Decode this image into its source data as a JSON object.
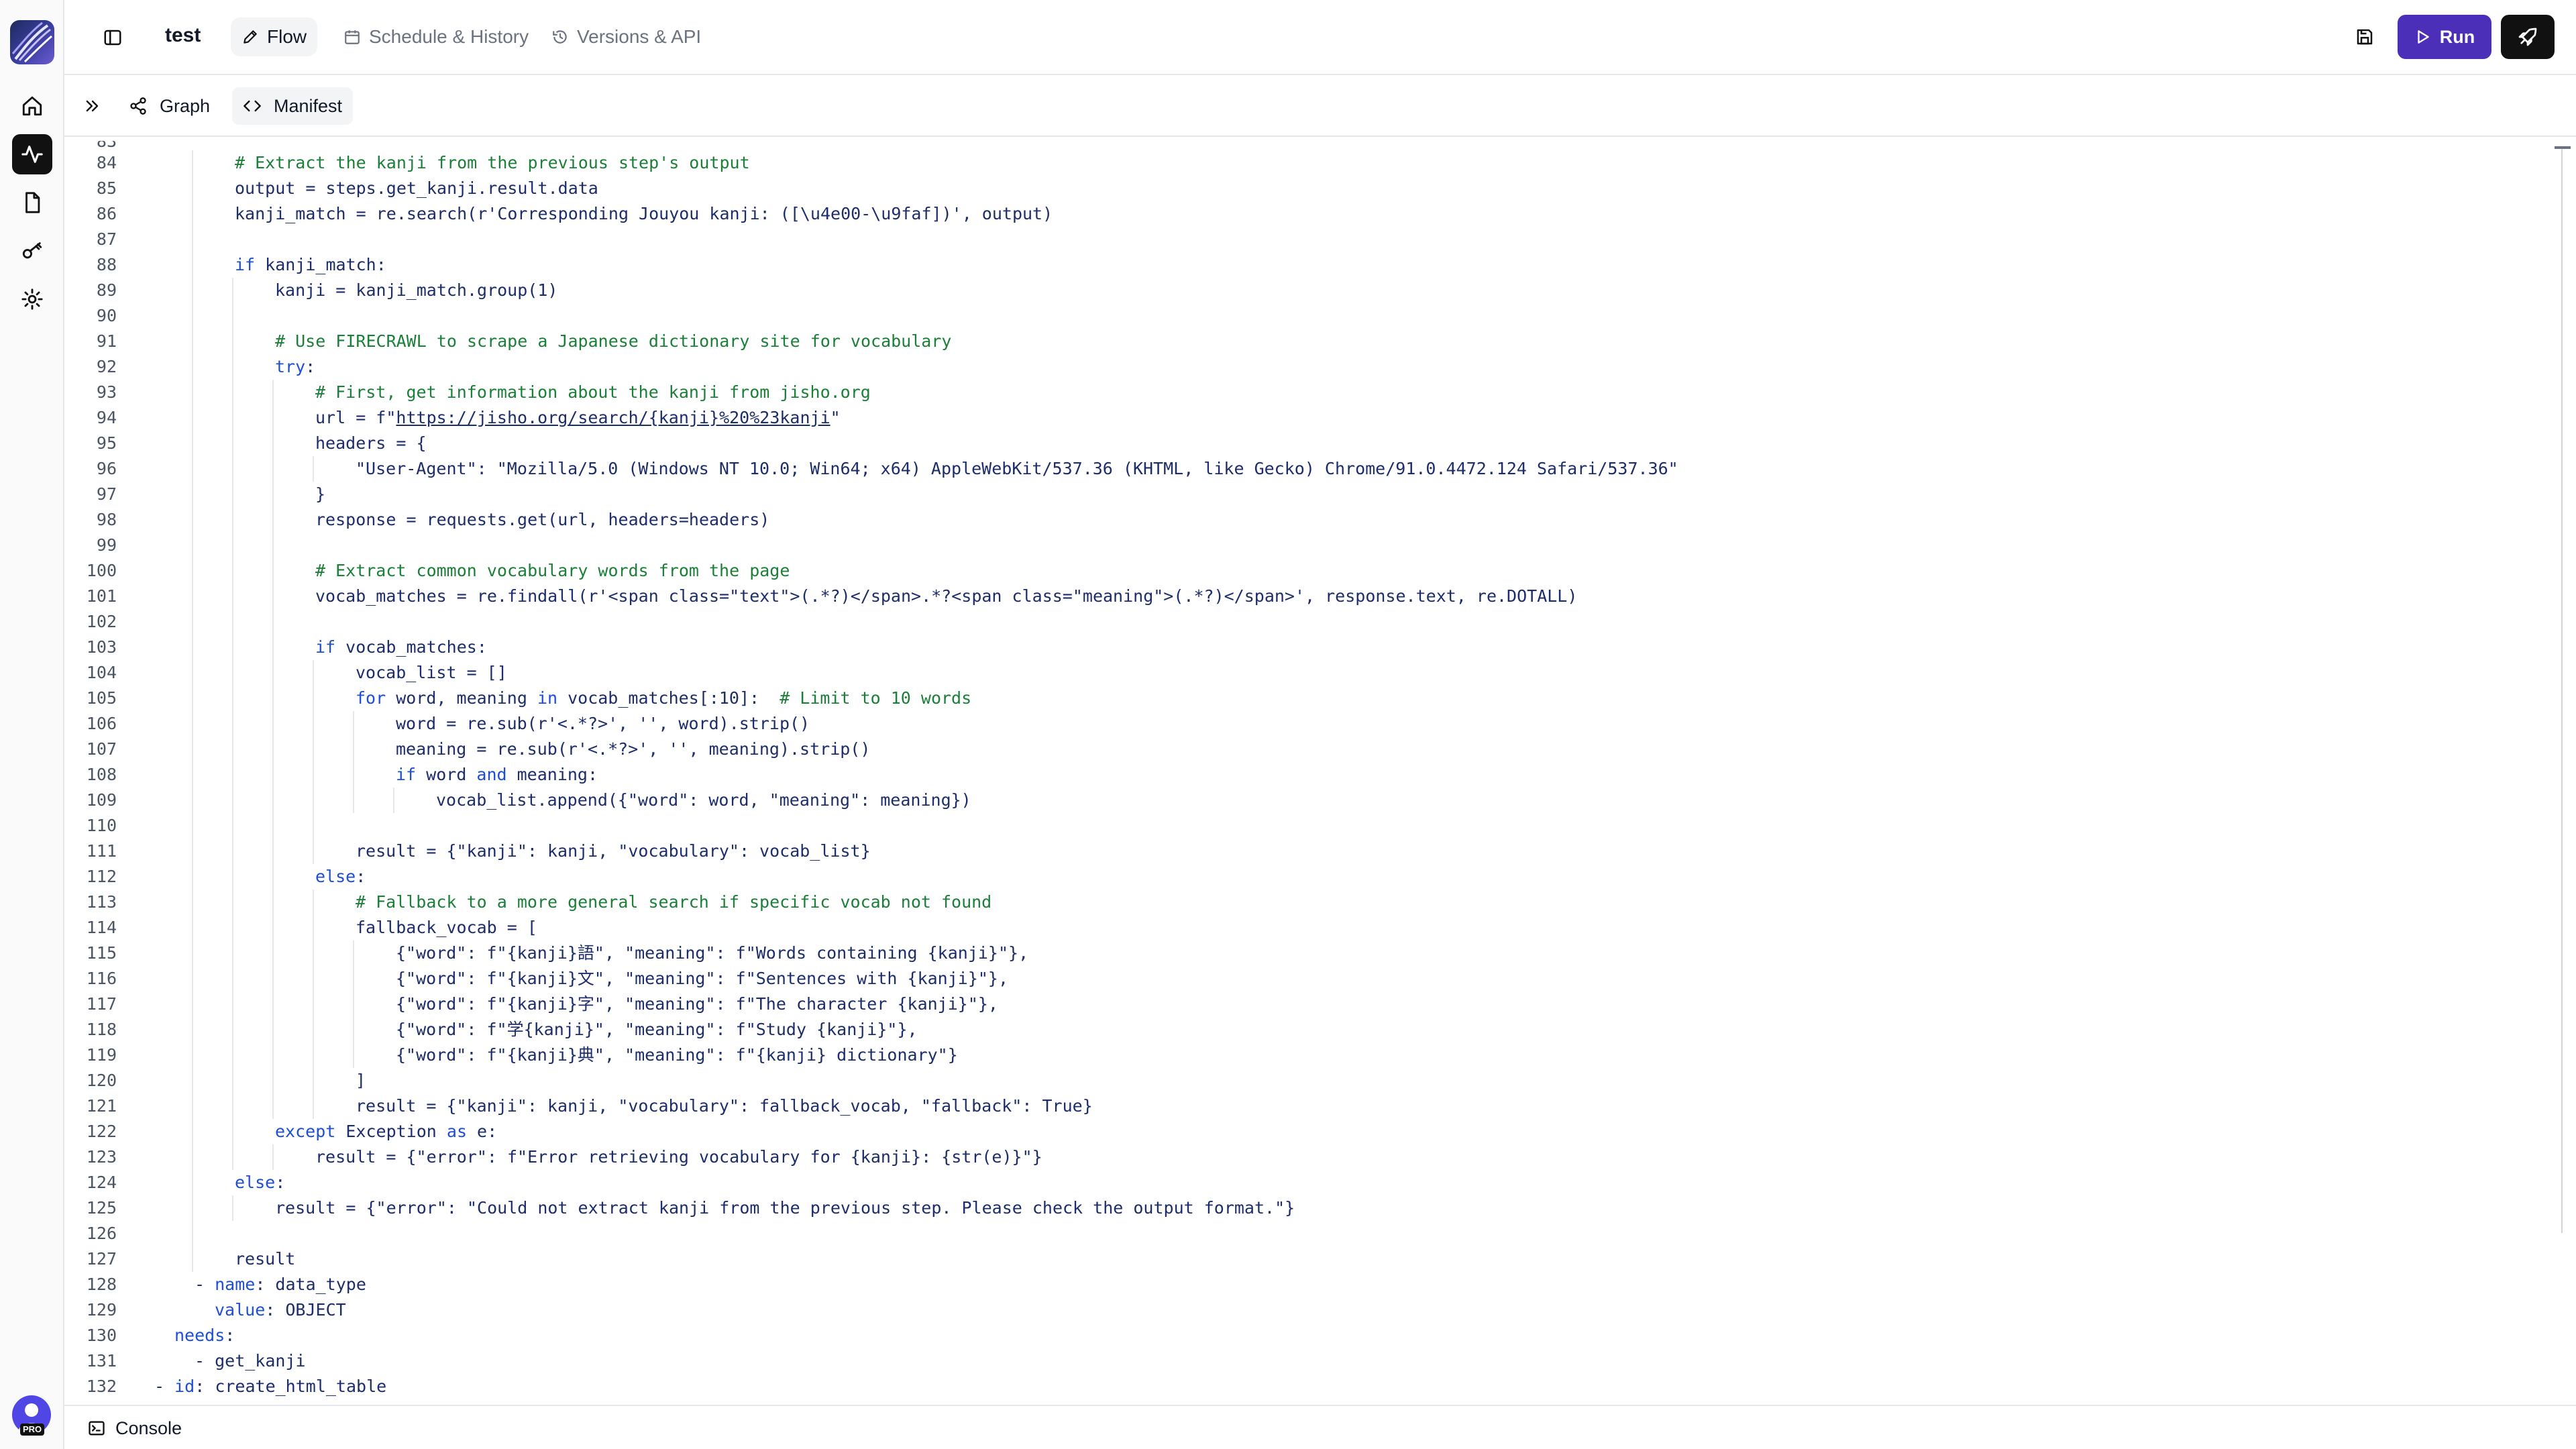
{
  "header": {
    "project_title": "test",
    "tabs": [
      {
        "label": "Flow",
        "icon": "pencil-icon",
        "active": true
      },
      {
        "label": "Schedule & History",
        "icon": "calendar-icon",
        "active": false
      },
      {
        "label": "Versions & API",
        "icon": "history-icon",
        "active": false
      }
    ],
    "run_label": "Run",
    "accent_color": "#4c2fb8"
  },
  "subheader": {
    "tabs": [
      {
        "label": "Graph",
        "icon": "share-nodes-icon",
        "active": false
      },
      {
        "label": "Manifest",
        "icon": "code-brackets-icon",
        "active": true
      }
    ]
  },
  "rail": {
    "items": [
      "home-icon",
      "activity-icon",
      "file-icon",
      "key-icon",
      "settings-icon"
    ],
    "active_item": "activity-icon",
    "badge": "PRO"
  },
  "editor": {
    "lines": [
      {
        "n": "84",
        "i": 2,
        "t": [
          [
            "cm",
            "# Extract the kanji from the previous step's output"
          ]
        ]
      },
      {
        "n": "85",
        "i": 2,
        "t": [
          [
            "",
            "output = steps.get_kanji.result.data"
          ]
        ]
      },
      {
        "n": "86",
        "i": 2,
        "t": [
          [
            "",
            "kanji_match = re.search(r'Corresponding Jouyou kanji: ([\\u4e00-\\u9faf])', output)"
          ]
        ]
      },
      {
        "n": "87",
        "i": 2,
        "t": []
      },
      {
        "n": "88",
        "i": 2,
        "t": [
          [
            "kw",
            "if"
          ],
          [
            "",
            " kanji_match:"
          ]
        ]
      },
      {
        "n": "89",
        "i": 3,
        "t": [
          [
            "",
            "kanji = kanji_match.group(1)"
          ]
        ]
      },
      {
        "n": "90",
        "i": 3,
        "t": []
      },
      {
        "n": "91",
        "i": 3,
        "t": [
          [
            "cm",
            "# Use FIRECRAWL to scrape a Japanese dictionary site for vocabulary"
          ]
        ]
      },
      {
        "n": "92",
        "i": 3,
        "t": [
          [
            "kw",
            "try"
          ],
          [
            "",
            ":"
          ]
        ]
      },
      {
        "n": "93",
        "i": 4,
        "t": [
          [
            "cm",
            "# First, get information about the kanji from jisho.org"
          ]
        ]
      },
      {
        "n": "94",
        "i": 4,
        "t": [
          [
            "",
            "url = f\""
          ],
          [
            "lnk",
            "https://jisho.org/search/{kanji}%20%23kanji"
          ],
          [
            "",
            "\""
          ]
        ]
      },
      {
        "n": "95",
        "i": 4,
        "t": [
          [
            "",
            "headers = {"
          ]
        ]
      },
      {
        "n": "96",
        "i": 5,
        "t": [
          [
            "",
            "\"User-Agent\": \"Mozilla/5.0 (Windows NT 10.0; Win64; x64) AppleWebKit/537.36 (KHTML, like Gecko) Chrome/91.0.4472.124 Safari/537.36\""
          ]
        ]
      },
      {
        "n": "97",
        "i": 4,
        "t": [
          [
            "",
            "}"
          ]
        ]
      },
      {
        "n": "98",
        "i": 4,
        "t": [
          [
            "",
            "response = requests.get(url, headers=headers)"
          ]
        ]
      },
      {
        "n": "99",
        "i": 4,
        "t": []
      },
      {
        "n": "100",
        "i": 4,
        "t": [
          [
            "cm",
            "# Extract common vocabulary words from the page"
          ]
        ]
      },
      {
        "n": "101",
        "i": 4,
        "t": [
          [
            "",
            "vocab_matches = re.findall(r'<span class=\"text\">(.*?)</span>.*?<span class=\"meaning\">(.*?)</span>', response.text, re.DOTALL)"
          ]
        ]
      },
      {
        "n": "102",
        "i": 4,
        "t": []
      },
      {
        "n": "103",
        "i": 4,
        "t": [
          [
            "kw",
            "if"
          ],
          [
            "",
            " vocab_matches:"
          ]
        ]
      },
      {
        "n": "104",
        "i": 5,
        "t": [
          [
            "",
            "vocab_list = []"
          ]
        ]
      },
      {
        "n": "105",
        "i": 5,
        "t": [
          [
            "kw",
            "for"
          ],
          [
            "",
            " word, meaning "
          ],
          [
            "kw",
            "in"
          ],
          [
            "",
            " vocab_matches[:10]:  "
          ],
          [
            "cm",
            "# Limit to 10 words"
          ]
        ]
      },
      {
        "n": "106",
        "i": 6,
        "t": [
          [
            "",
            "word = re.sub(r'<.*?>', '', word).strip()"
          ]
        ]
      },
      {
        "n": "107",
        "i": 6,
        "t": [
          [
            "",
            "meaning = re.sub(r'<.*?>', '', meaning).strip()"
          ]
        ]
      },
      {
        "n": "108",
        "i": 6,
        "t": [
          [
            "kw",
            "if"
          ],
          [
            "",
            " word "
          ],
          [
            "kw",
            "and"
          ],
          [
            "",
            " meaning:"
          ]
        ]
      },
      {
        "n": "109",
        "i": 7,
        "t": [
          [
            "",
            "vocab_list.append({\"word\": word, \"meaning\": meaning})"
          ]
        ]
      },
      {
        "n": "110",
        "i": 5,
        "t": []
      },
      {
        "n": "111",
        "i": 5,
        "t": [
          [
            "",
            "result = {\"kanji\": kanji, \"vocabulary\": vocab_list}"
          ]
        ]
      },
      {
        "n": "112",
        "i": 4,
        "t": [
          [
            "kw",
            "else"
          ],
          [
            "",
            ":"
          ]
        ]
      },
      {
        "n": "113",
        "i": 5,
        "t": [
          [
            "cm",
            "# Fallback to a more general search if specific vocab not found"
          ]
        ]
      },
      {
        "n": "114",
        "i": 5,
        "t": [
          [
            "",
            "fallback_vocab = ["
          ]
        ]
      },
      {
        "n": "115",
        "i": 6,
        "t": [
          [
            "",
            "{\"word\": f\"{kanji}語\", \"meaning\": f\"Words containing {kanji}\"},"
          ]
        ]
      },
      {
        "n": "116",
        "i": 6,
        "t": [
          [
            "",
            "{\"word\": f\"{kanji}文\", \"meaning\": f\"Sentences with {kanji}\"},"
          ]
        ]
      },
      {
        "n": "117",
        "i": 6,
        "t": [
          [
            "",
            "{\"word\": f\"{kanji}字\", \"meaning\": f\"The character {kanji}\"},"
          ]
        ]
      },
      {
        "n": "118",
        "i": 6,
        "t": [
          [
            "",
            "{\"word\": f\"学{kanji}\", \"meaning\": f\"Study {kanji}\"},"
          ]
        ]
      },
      {
        "n": "119",
        "i": 6,
        "t": [
          [
            "",
            "{\"word\": f\"{kanji}典\", \"meaning\": f\"{kanji} dictionary\"}"
          ]
        ]
      },
      {
        "n": "120",
        "i": 5,
        "t": [
          [
            "",
            "]"
          ]
        ]
      },
      {
        "n": "121",
        "i": 5,
        "t": [
          [
            "",
            "result = {\"kanji\": kanji, \"vocabulary\": fallback_vocab, \"fallback\": True}"
          ]
        ]
      },
      {
        "n": "122",
        "i": 3,
        "t": [
          [
            "kw",
            "except"
          ],
          [
            "",
            " Exception "
          ],
          [
            "kw",
            "as"
          ],
          [
            "",
            " e:"
          ]
        ]
      },
      {
        "n": "123",
        "i": 4,
        "t": [
          [
            "",
            "result = {\"error\": f\"Error retrieving vocabulary for {kanji}: {str(e)}\"}"
          ]
        ]
      },
      {
        "n": "124",
        "i": 2,
        "t": [
          [
            "kw",
            "else"
          ],
          [
            "",
            ":"
          ]
        ]
      },
      {
        "n": "125",
        "i": 3,
        "t": [
          [
            "",
            "result = {\"error\": \"Could not extract kanji from the previous step. Please check the output format.\"}"
          ]
        ]
      },
      {
        "n": "126",
        "i": 2,
        "t": []
      },
      {
        "n": "127",
        "i": 2,
        "t": [
          [
            "",
            "result"
          ]
        ]
      },
      {
        "n": "128",
        "i": 1,
        "t": [
          [
            "",
            "- "
          ],
          [
            "kw",
            "name"
          ],
          [
            "",
            ": data_type"
          ]
        ]
      },
      {
        "n": "129",
        "i": 1.5,
        "t": [
          [
            "kw",
            "value"
          ],
          [
            "",
            ": OBJECT"
          ]
        ]
      },
      {
        "n": "130",
        "i": 0.5,
        "t": [
          [
            "kw",
            "needs"
          ],
          [
            "",
            ":"
          ]
        ]
      },
      {
        "n": "131",
        "i": 1,
        "t": [
          [
            "",
            "- get_kanji"
          ]
        ]
      },
      {
        "n": "132",
        "i": 0,
        "t": [
          [
            "",
            "- "
          ],
          [
            "kw",
            "id"
          ],
          [
            "",
            ": create_html_table"
          ]
        ]
      }
    ]
  },
  "console": {
    "label": "Console"
  }
}
